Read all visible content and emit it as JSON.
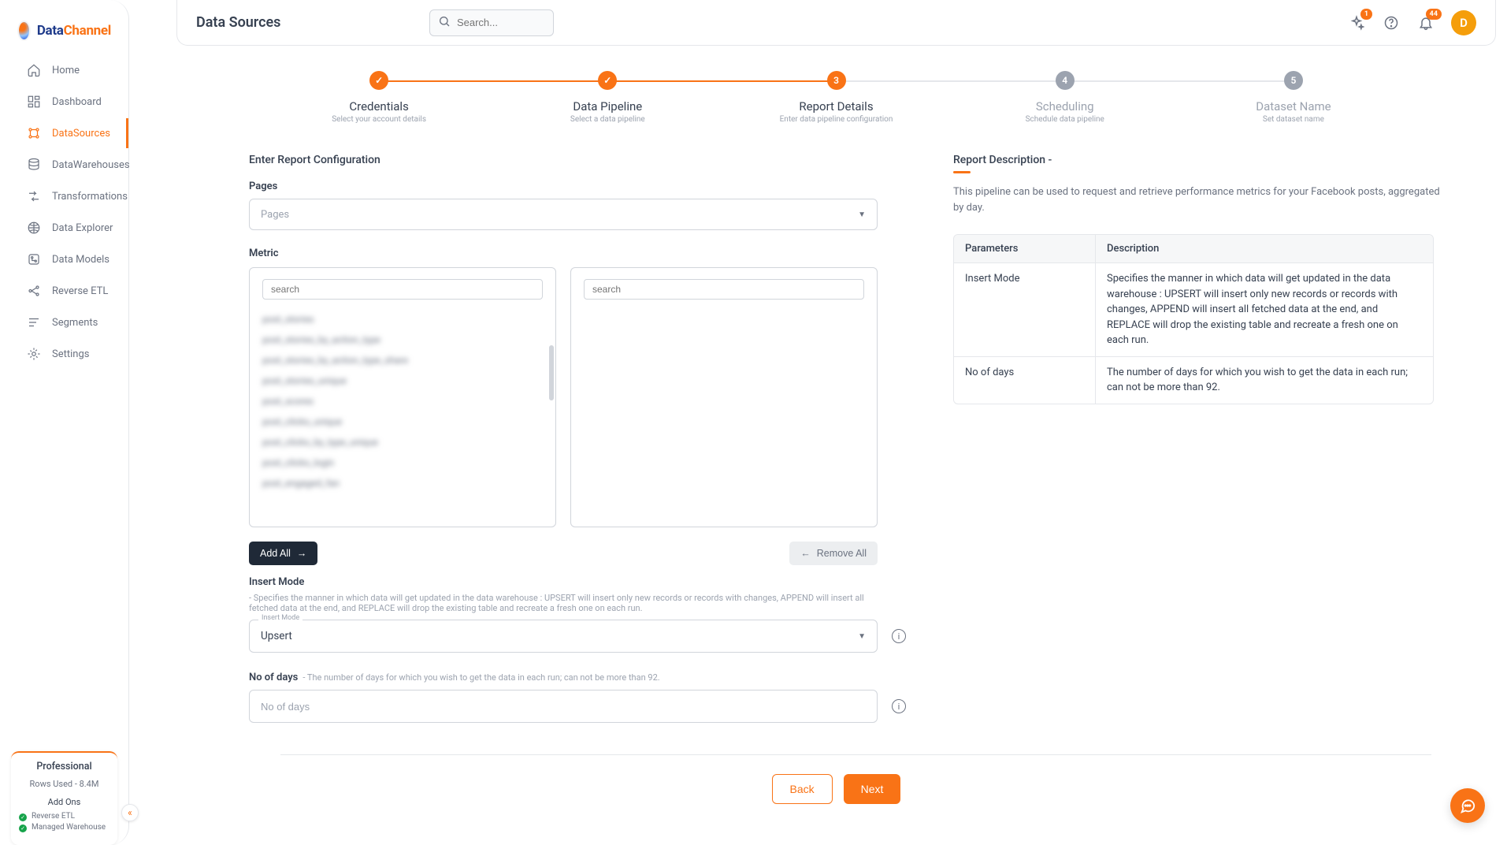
{
  "brand": {
    "part1": "Data",
    "part2": "Channel"
  },
  "page_title": "Data Sources",
  "search": {
    "placeholder": "Search..."
  },
  "notifications": {
    "sparkle_badge": "1",
    "bell_badge": "44"
  },
  "avatar_initial": "D",
  "sidebar": {
    "items": [
      {
        "label": "Home"
      },
      {
        "label": "Dashboard"
      },
      {
        "label": "DataSources"
      },
      {
        "label": "DataWarehouses"
      },
      {
        "label": "Transformations"
      },
      {
        "label": "Data Explorer"
      },
      {
        "label": "Data Models"
      },
      {
        "label": "Reverse ETL"
      },
      {
        "label": "Segments"
      },
      {
        "label": "Settings"
      }
    ],
    "plan": {
      "name": "Professional",
      "rows": "Rows Used - 8.4M",
      "addons_title": "Add Ons",
      "addons": [
        {
          "label": "Reverse ETL"
        },
        {
          "label": "Managed Warehouse"
        }
      ]
    }
  },
  "stepper": [
    {
      "title": "Credentials",
      "sub": "Select your account details",
      "state": "done",
      "mark": "✓"
    },
    {
      "title": "Data Pipeline",
      "sub": "Select a data pipeline",
      "state": "done",
      "mark": "✓"
    },
    {
      "title": "Report Details",
      "sub": "Enter data pipeline configuration",
      "state": "current",
      "mark": "3"
    },
    {
      "title": "Scheduling",
      "sub": "Schedule data pipeline",
      "state": "pending",
      "mark": "4"
    },
    {
      "title": "Dataset Name",
      "sub": "Set dataset name",
      "state": "pending",
      "mark": "5"
    }
  ],
  "form": {
    "heading": "Enter Report Configuration",
    "pages_label": "Pages",
    "pages_placeholder": "Pages",
    "metric_label": "Metric",
    "metric_search_placeholder": "search",
    "metric_options": [
      "post_stories",
      "post_stories_by_action_type",
      "post_stories_by_action_type_share",
      "post_stories_unique",
      "post_scores",
      "post_clicks_unique",
      "post_clicks_by_type_unique",
      "post_clicks_login",
      "post_engaged_fan"
    ],
    "add_all_label": "Add All",
    "remove_all_label": "Remove All",
    "insert_mode_label": "Insert Mode",
    "insert_mode_desc": " - Specifies the manner in which data will get updated in the data warehouse : UPSERT will insert only new records or records with changes, APPEND will insert all fetched data at the end, and REPLACE will drop the existing table and recreate a fresh one on each run.",
    "insert_mode_float": "Insert Mode",
    "insert_mode_value": "Upsert",
    "no_of_days_label": "No of days",
    "no_of_days_desc": " - The number of days for which you wish to get the data in each run; can not be more than 92.",
    "no_of_days_placeholder": "No of days",
    "back_label": "Back",
    "next_label": "Next"
  },
  "description": {
    "title": "Report Description -",
    "text": "This pipeline can be used to request and retrieve performance metrics for your Facebook posts, aggregated by day.",
    "table": {
      "col_param": "Parameters",
      "col_desc": "Description",
      "rows": [
        {
          "param": "Insert Mode",
          "desc": "Specifies the manner in which data will get updated in the data warehouse : UPSERT will insert only new records or records with changes, APPEND will insert all fetched data at the end, and REPLACE will drop the existing table and recreate a fresh one on each run."
        },
        {
          "param": "No of days",
          "desc": "The number of days for which you wish to get the data in each run; can not be more than 92."
        }
      ]
    }
  }
}
